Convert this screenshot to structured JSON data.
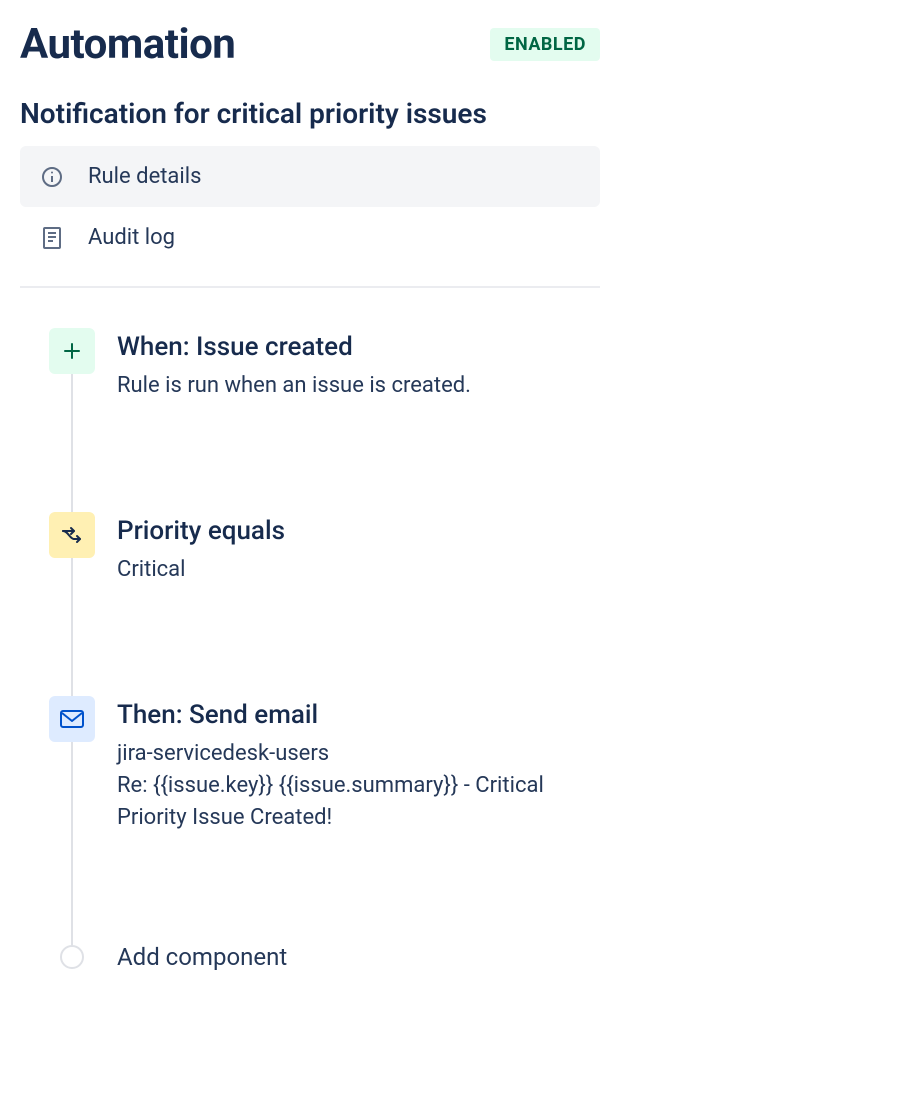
{
  "header": {
    "title": "Automation",
    "status": "ENABLED"
  },
  "rule": {
    "name": "Notification for critical priority issues"
  },
  "nav": {
    "details_label": "Rule details",
    "audit_label": "Audit log"
  },
  "steps": {
    "trigger": {
      "title": "When: Issue created",
      "desc": "Rule is run when an issue is created."
    },
    "condition": {
      "title": "Priority equals",
      "desc": "Critical"
    },
    "action": {
      "title": "Then: Send email",
      "desc": "jira-servicedesk-users\nRe: {{issue.key}} {{issue.summary}} - Critical Priority Issue Created!"
    }
  },
  "add_component_label": "Add component"
}
